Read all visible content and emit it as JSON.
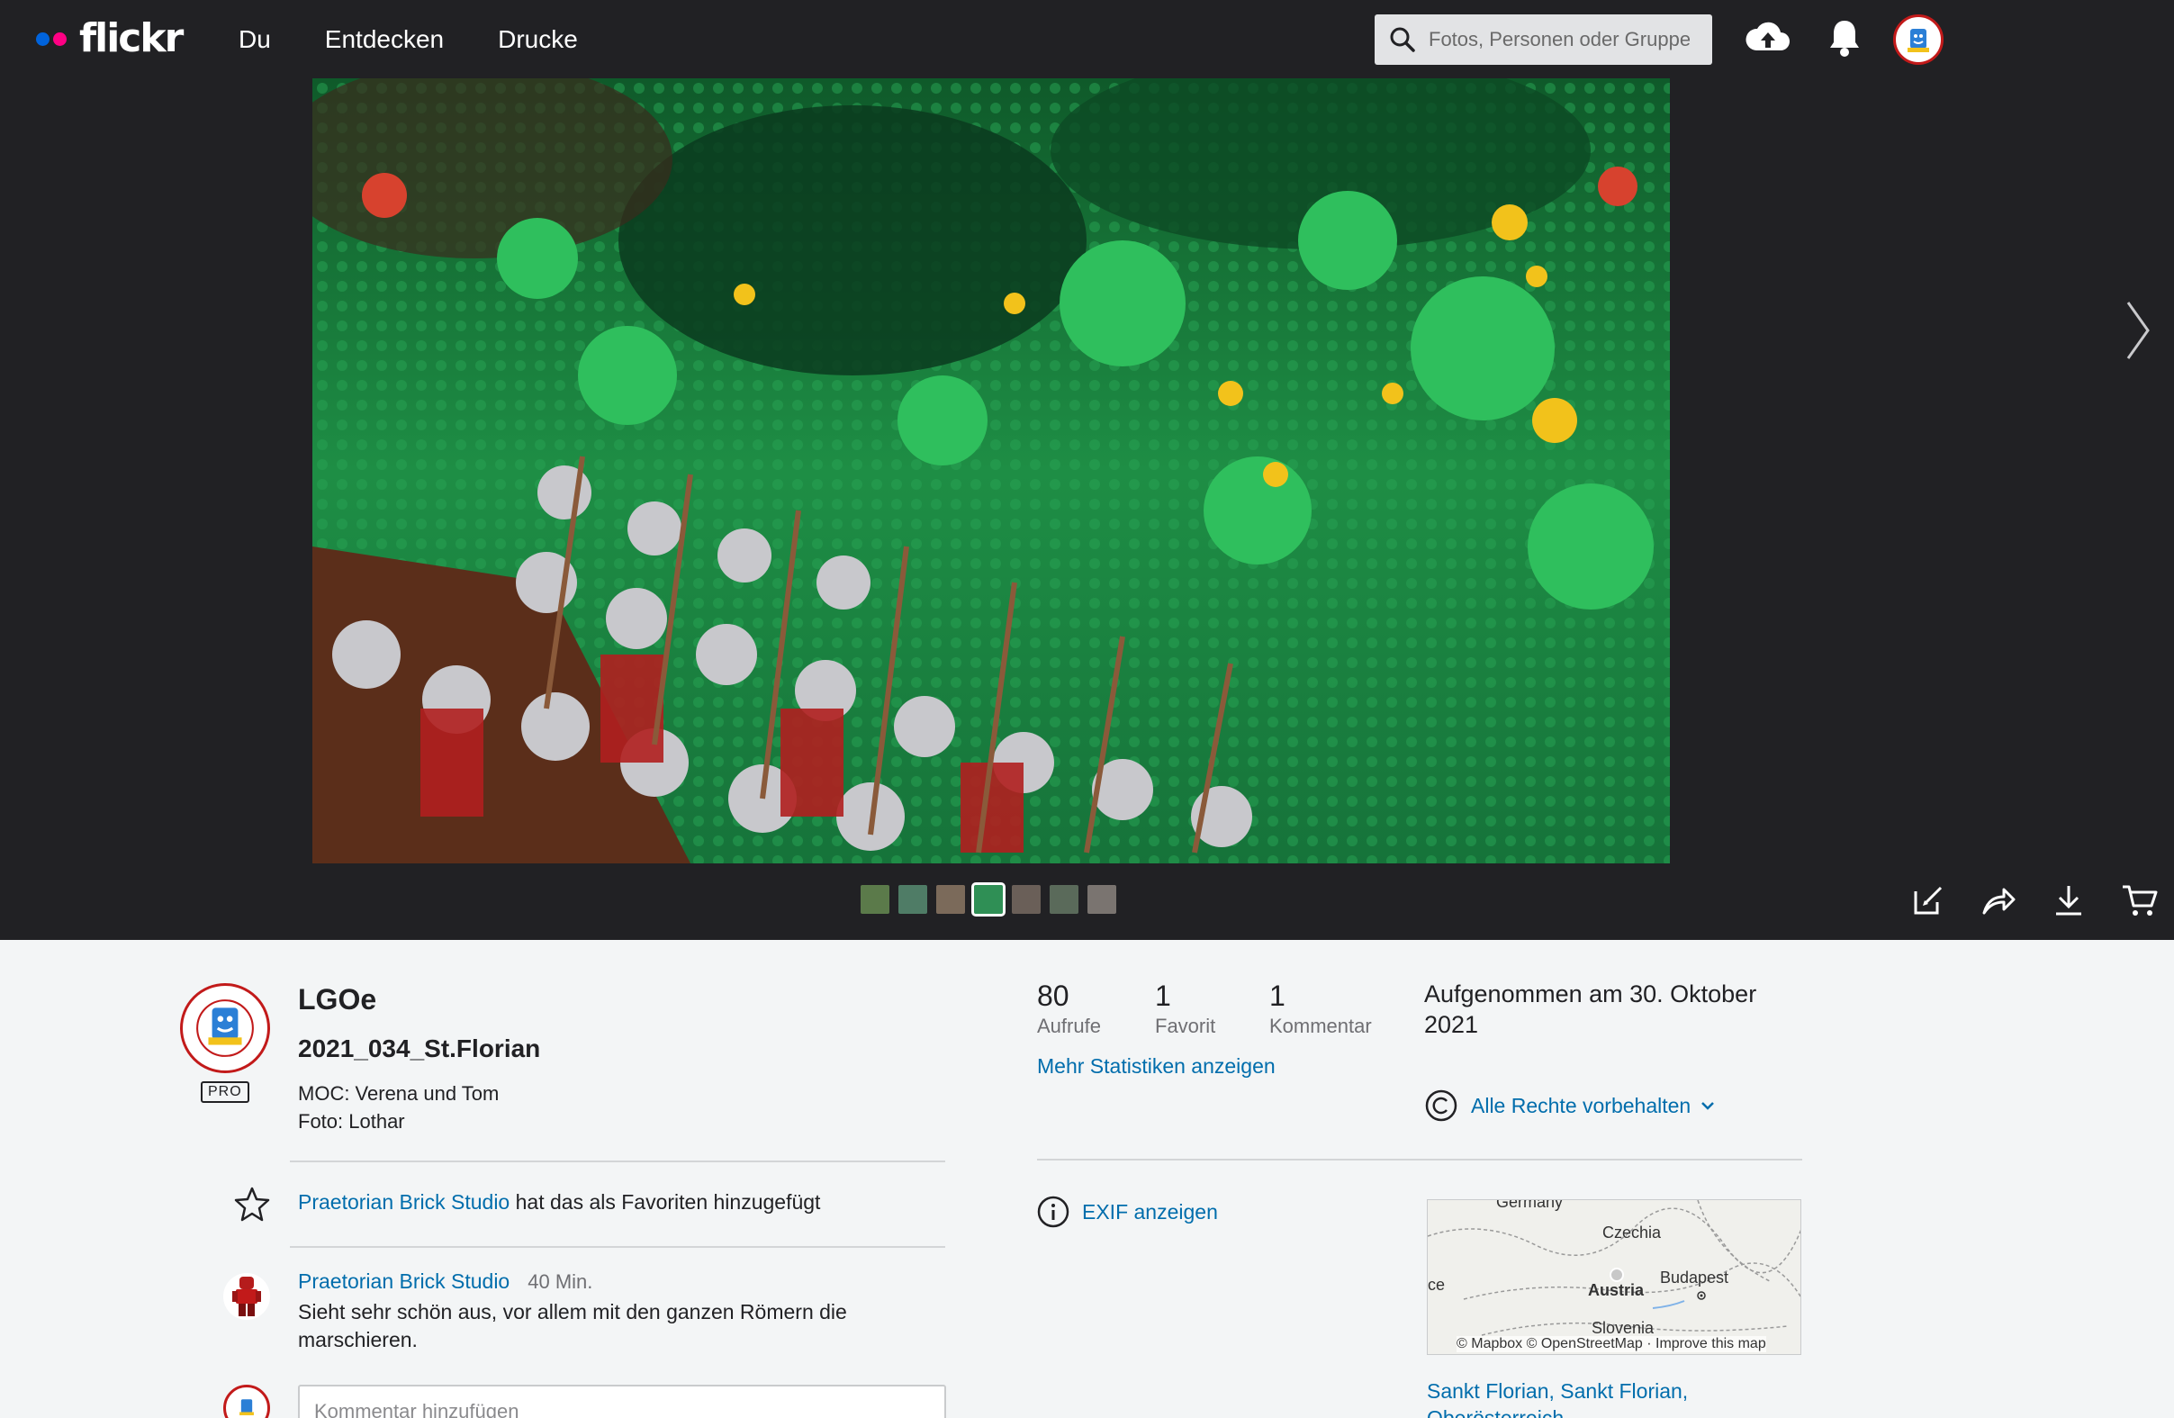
{
  "nav": {
    "logo_text": "flickr",
    "links": [
      "Du",
      "Entdecken",
      "Drucke"
    ],
    "search_placeholder": "Fotos, Personen oder Gruppen"
  },
  "photo": {
    "description": "Lego diorama: Roman legionaries with spears marching into a green forest with medieval minifigures"
  },
  "owner": {
    "name": "LGOe",
    "pro_label": "PRO"
  },
  "title": "2021_034_St.Florian",
  "description_lines": [
    "MOC: Verena und Tom",
    "Foto: Lothar"
  ],
  "favorite_activity": {
    "user": "Praetorian Brick Studio",
    "text": "hat das als Favoriten hinzugefügt"
  },
  "comment": {
    "author": "Praetorian Brick Studio",
    "time": "40 Min.",
    "text": "Sieht sehr schön aus, vor allem mit den ganzen Römern die marschieren."
  },
  "comment_input_placeholder": "Kommentar hinzufügen",
  "stats": [
    {
      "value": "80",
      "label": "Aufrufe"
    },
    {
      "value": "1",
      "label": "Favorit"
    },
    {
      "value": "1",
      "label": "Kommentar"
    }
  ],
  "more_stats_label": "Mehr Statistiken anzeigen",
  "taken_text": "Aufgenommen am 30. Oktober 2021",
  "rights_label": "Alle Rechte vorbehalten",
  "exif_label": "EXIF anzeigen",
  "map": {
    "labels": [
      "Germany",
      "Czechia",
      "Austria",
      "Budapest",
      "Slovenia",
      "ce"
    ],
    "attribution": "© Mapbox © OpenStreetMap · Improve this map"
  },
  "location_lines": [
    "Sankt Florian, Sankt Florian,",
    "Oberösterreich"
  ],
  "colors": {
    "nav_bg": "#212124",
    "link": "#006dac",
    "avatar_ring": "#c21a1a",
    "flickr_blue": "#0063dc",
    "flickr_pink": "#ff0084"
  }
}
